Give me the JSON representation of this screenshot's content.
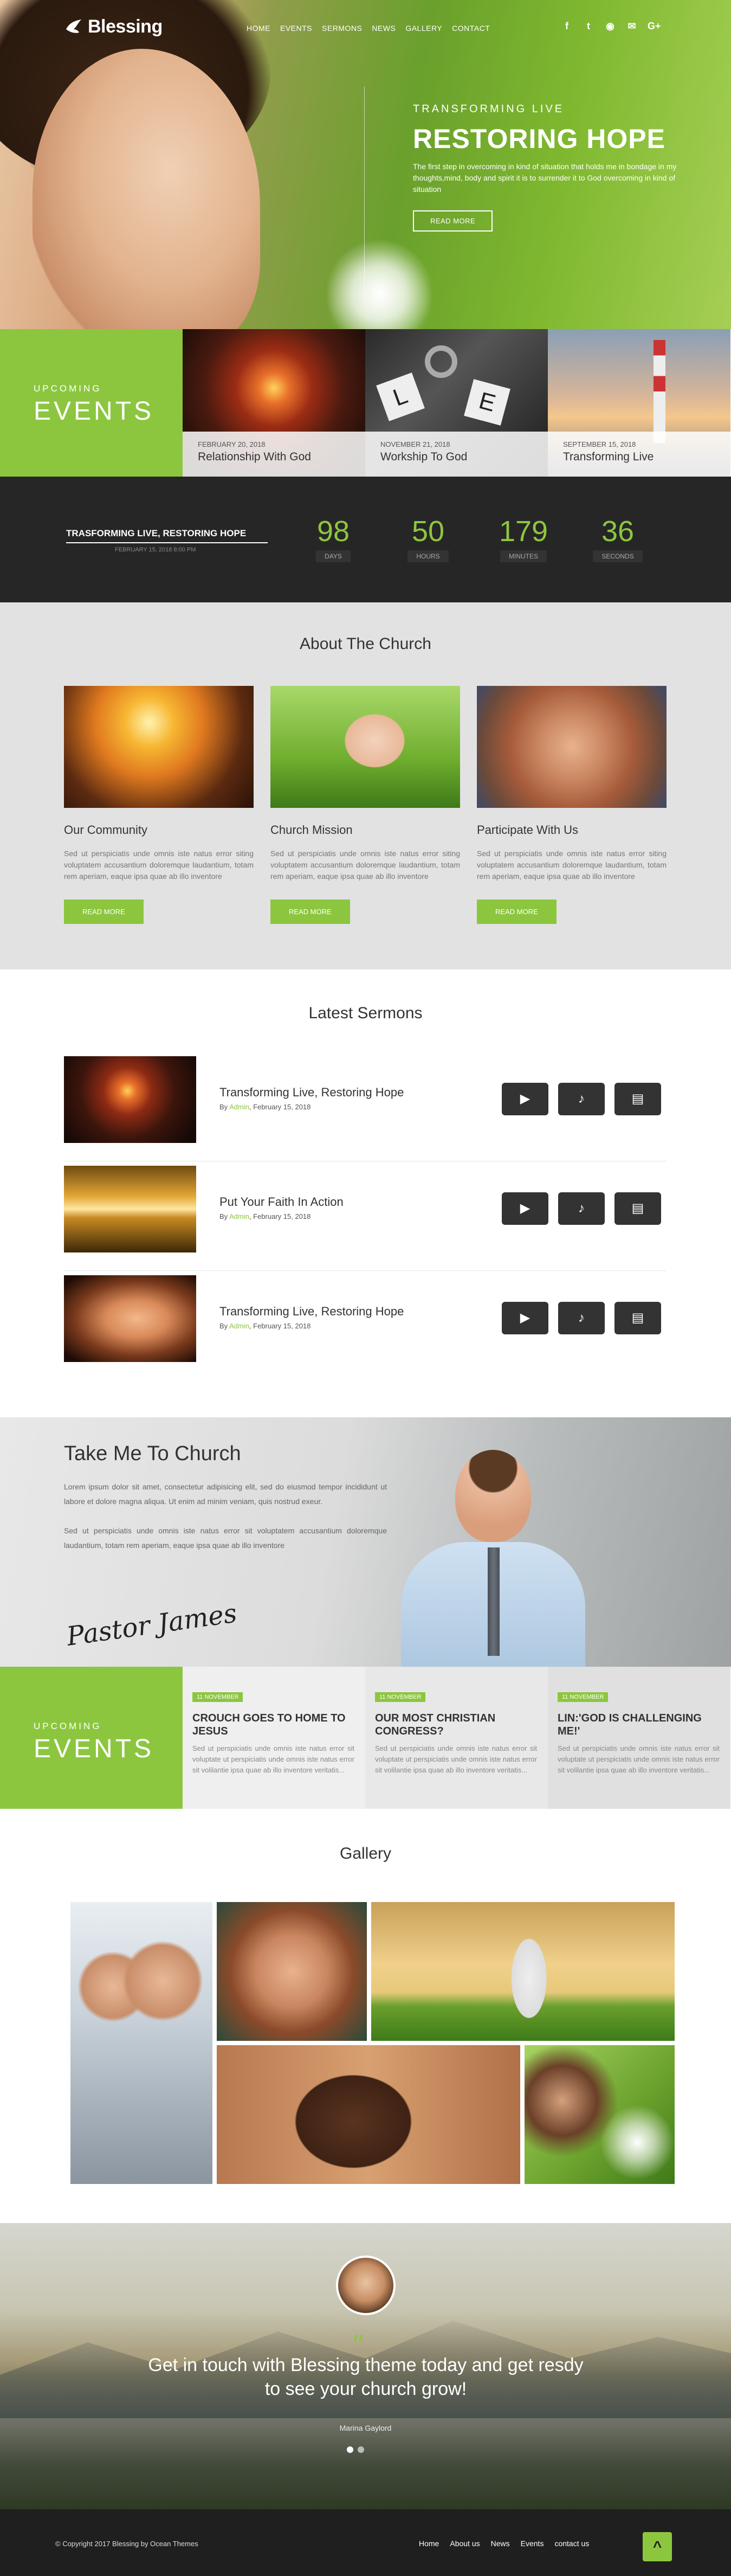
{
  "brand": {
    "name": "Blessing"
  },
  "nav": {
    "items": [
      "HOME",
      "EVENTS",
      "SERMONS",
      "NEWS",
      "GALLERY",
      "CONTACT"
    ]
  },
  "social": {
    "icons": [
      "facebook-icon",
      "twitter-icon",
      "rss-icon",
      "mail-icon",
      "google-plus-icon"
    ],
    "glyphs": [
      "f",
      "t",
      "◉",
      "✉",
      "G+"
    ]
  },
  "hero": {
    "kicker": "TRANSFORMING LIVE",
    "title": "RESTORING HOPE",
    "text": "The first step in overcoming in kind of situation that holds me in bondage in my thoughts,mind, body and spirit it is to surrender it to God overcoming in kind of situation",
    "button": "READ MORE"
  },
  "events": {
    "label_small": "UPCOMING",
    "label_big": "EVENTS",
    "cards": [
      {
        "date": "FEBRUARY 20, 2018",
        "title": "Relationship With God"
      },
      {
        "date": "NOVEMBER 21, 2018",
        "title": "Workship To God"
      },
      {
        "date": "SEPTEMBER 15, 2018",
        "title": "Transforming Live"
      }
    ]
  },
  "countdown": {
    "title": "TRASFORMING LIVE, RESTORING HOPE",
    "subtitle": "FEBRUARY 15, 2018 8:00 PM",
    "items": [
      {
        "value": "98",
        "unit": "DAYS"
      },
      {
        "value": "50",
        "unit": "HOURS"
      },
      {
        "value": "179",
        "unit": "MINUTES"
      },
      {
        "value": "36",
        "unit": "SECONDS"
      }
    ]
  },
  "about": {
    "heading": "About The Church",
    "columns": [
      {
        "title": "Our Community",
        "text": "Sed ut perspiciatis unde omnis iste natus error siting voluptatem accusantium doloremque laudantium, totam rem aperiam, eaque ipsa quae ab illo inventore",
        "button": "READ MORE"
      },
      {
        "title": "Church Mission",
        "text": "Sed ut perspiciatis unde omnis iste natus error siting voluptatem accusantium doloremque laudantium, totam rem aperiam, eaque ipsa quae ab illo inventore",
        "button": "READ MORE"
      },
      {
        "title": "Participate With Us",
        "text": "Sed ut perspiciatis unde omnis iste natus error siting voluptatem accusantium doloremque laudantium, totam rem aperiam, eaque ipsa quae ab illo inventore",
        "button": "READ MORE"
      }
    ]
  },
  "sermons": {
    "heading": "Latest Sermons",
    "items": [
      {
        "title": "Transforming Live, Restoring Hope",
        "by": "By ",
        "author": "Admin",
        "date": ", February 15, 2018"
      },
      {
        "title": "Put Your Faith In Action",
        "by": "By ",
        "author": "Admin",
        "date": ", February 15, 2018"
      },
      {
        "title": "Transforming Live, Restoring Hope",
        "by": "By ",
        "author": "Admin",
        "date": ", February 15, 2018"
      }
    ],
    "action_icons": [
      "video-icon",
      "audio-icon",
      "pdf-icon"
    ]
  },
  "pastor": {
    "heading": "Take Me To Church",
    "p1": "Lorem ipsum dolor sit amet, consectetur adipisicing elit, sed do eiusmod tempor incididunt ut labore et dolore magna aliqua. Ut enim ad minim veniam, quis nostrud exeur.",
    "p2": "Sed ut perspiciatis unde omnis iste natus error sit voluptatem accusantium doloremque laudantium, totam rem aperiam, eaque ipsa quae ab illo inventore",
    "signature": "Pastor James"
  },
  "events2": {
    "label_small": "UPCOMING",
    "label_big": "EVENTS",
    "cards": [
      {
        "tag": "11 NOVEMBER",
        "title": "CROUCH GOES TO HOME TO JESUS",
        "text": "Sed ut perspiciatis unde omnis iste natus error sit voluptate ut perspiciatis unde omnis iste natus error sit volilantie ipsa quae ab illo inventore veritatis..."
      },
      {
        "tag": "11 NOVEMBER",
        "title": "OUR MOST CHRISTIAN CONGRESS?",
        "text": "Sed ut perspiciatis unde omnis iste natus error sit voluptate ut perspiciatis unde omnis iste natus error sit volilantie ipsa quae ab illo inventore veritatis..."
      },
      {
        "tag": "11 NOVEMBER",
        "title": "LIN:'GOD IS CHALLENGING ME!'",
        "text": "Sed ut perspiciatis unde omnis iste natus error sit voluptate ut perspiciatis unde omnis iste natus error sit volilantie ipsa quae ab illo inventore veritatis..."
      }
    ]
  },
  "gallery": {
    "heading": "Gallery"
  },
  "testimonial": {
    "quote_mark": "“",
    "text": "Get in touch with Blessing theme today and get resdy to see your church grow!",
    "name": "Marina Gaylord"
  },
  "footer": {
    "copyright": "© Copyright 2017 Blessing by Ocean Themes",
    "links": [
      "Home",
      "About us",
      "News",
      "Events",
      "contact us"
    ],
    "top_glyph": "^"
  },
  "colors": {
    "accent": "#8cc63f",
    "dark": "#262626",
    "light_gray": "#e2e2e2"
  }
}
